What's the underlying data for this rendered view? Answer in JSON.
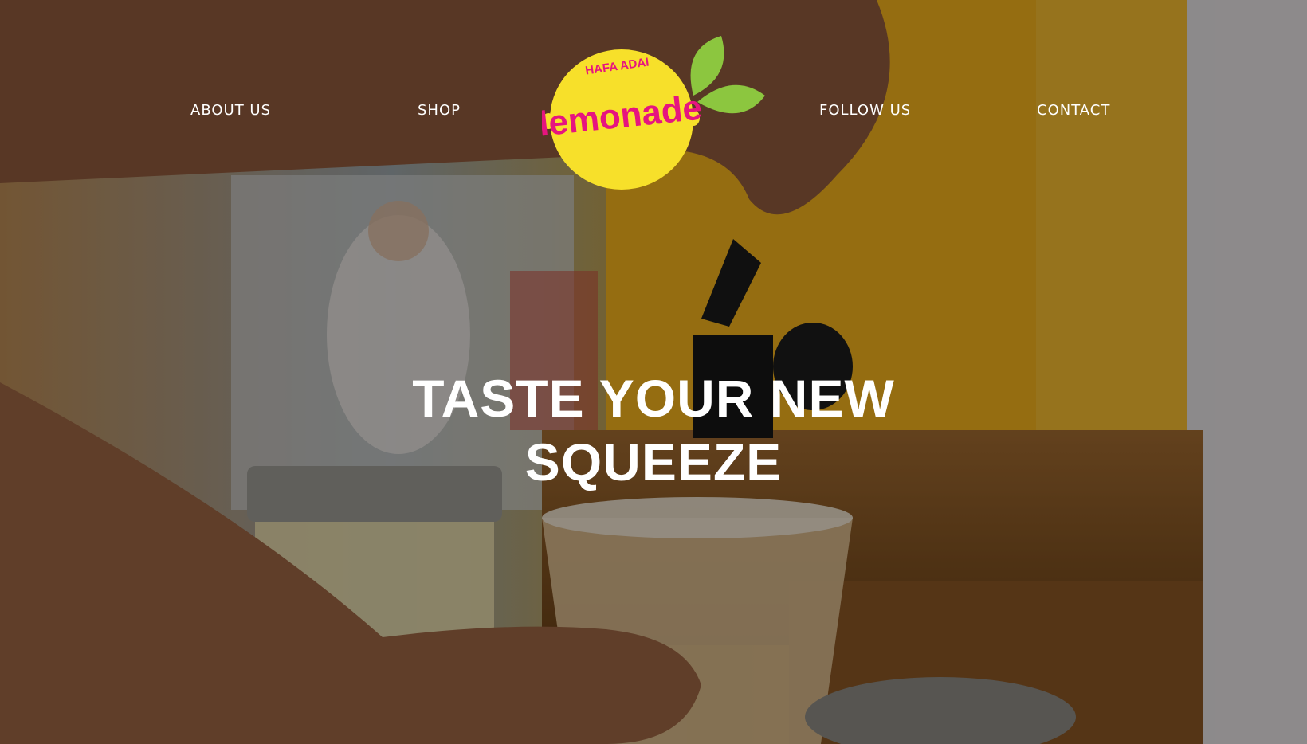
{
  "nav": {
    "about": "ABOUT US",
    "shop": "SHOP",
    "follow": "FOLLOW US",
    "contact": "CONTACT"
  },
  "logo": {
    "tagline": "HAFA ADAI",
    "word": "lemonade",
    "colors": {
      "lemon": "#F7E02A",
      "text": "#E6157F",
      "leaf": "#8CC63F"
    }
  },
  "hero": {
    "headline_line1": "TASTE YOUR NEW",
    "headline_line2": "SQUEEZE"
  }
}
